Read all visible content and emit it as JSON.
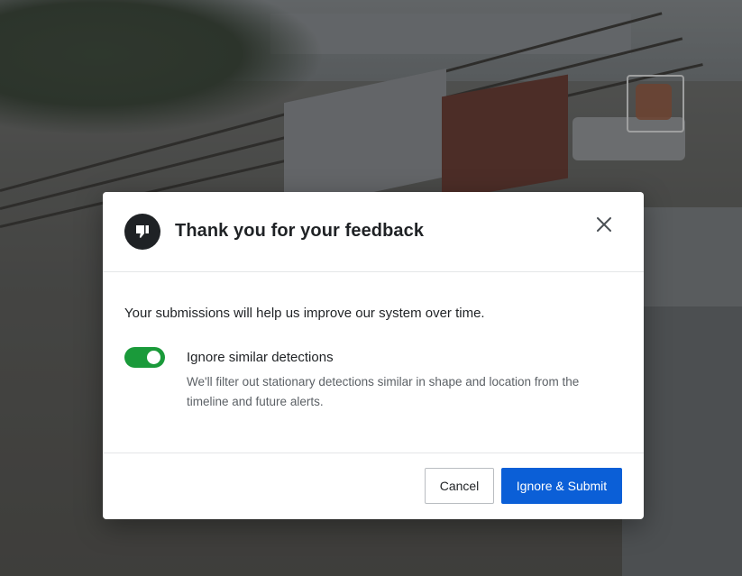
{
  "modal": {
    "title": "Thank you for your feedback",
    "header_icon": "thumbs-down-icon",
    "close_icon": "close-icon",
    "intro": "Your submissions will help us improve our system over time.",
    "option": {
      "enabled": true,
      "title": "Ignore similar detections",
      "description": "We'll filter out stationary detections similar in shape and location from the timeline and future alerts."
    },
    "buttons": {
      "cancel_label": "Cancel",
      "submit_label": "Ignore & Submit"
    }
  },
  "colors": {
    "toggle_on": "#1a9a3a",
    "primary": "#0b5fd7",
    "icon_background": "#1f2225"
  }
}
